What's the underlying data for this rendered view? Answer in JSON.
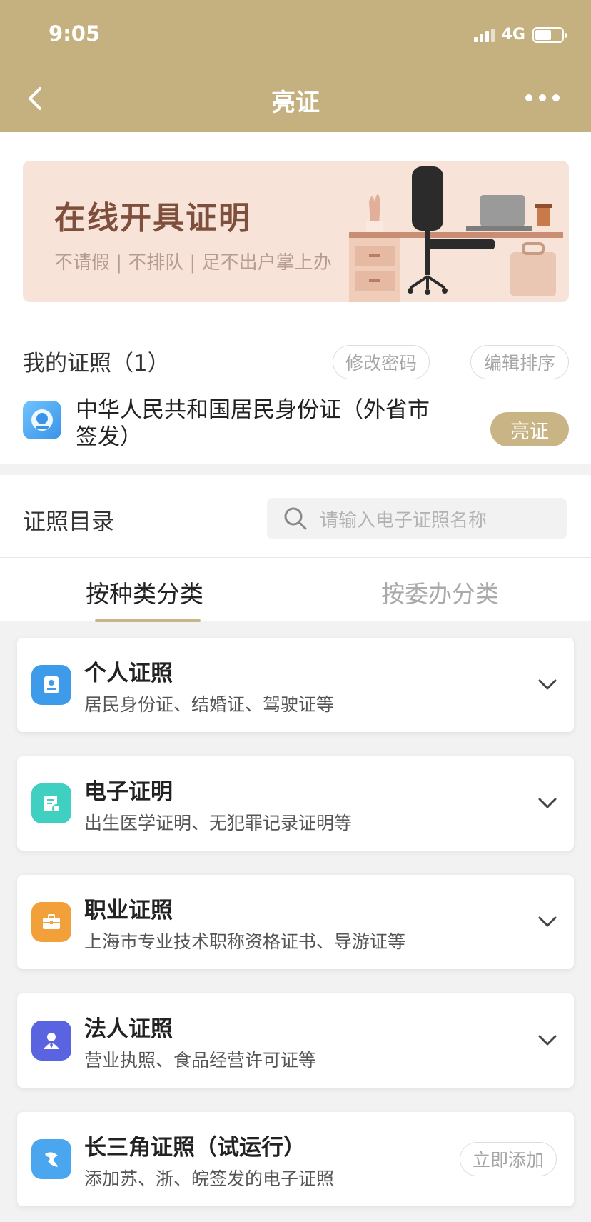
{
  "status_bar": {
    "time": "9:05",
    "network": "4G"
  },
  "nav": {
    "title": "亮证"
  },
  "banner": {
    "title": "在线开具证明",
    "subtitle": "不请假 | 不排队 | 足不出户掌上办"
  },
  "my_licenses": {
    "heading": "我的证照（1）",
    "change_password_label": "修改密码",
    "edit_order_label": "编辑排序",
    "items": [
      {
        "name": "中华人民共和国居民身份证（外省市签发）",
        "action_label": "亮证"
      }
    ]
  },
  "catalog": {
    "title": "证照目录",
    "search_placeholder": "请输入电子证照名称",
    "tabs": [
      {
        "label": "按种类分类",
        "active": true
      },
      {
        "label": "按委办分类",
        "active": false
      }
    ],
    "categories": [
      {
        "title": "个人证照",
        "subtitle": "居民身份证、结婚证、驾驶证等",
        "icon": "id-card-icon",
        "color": "#3d9be9"
      },
      {
        "title": "电子证明",
        "subtitle": "出生医学证明、无犯罪记录证明等",
        "icon": "certificate-icon",
        "color": "#3fd0c2"
      },
      {
        "title": "职业证照",
        "subtitle": "上海市专业技术职称资格证书、导游证等",
        "icon": "briefcase-icon",
        "color": "#f2a03a"
      },
      {
        "title": "法人证照",
        "subtitle": "营业执照、食品经营许可证等",
        "icon": "person-badge-icon",
        "color": "#5a63e0"
      },
      {
        "title": "长三角证照（试运行）",
        "subtitle": "添加苏、浙、皖签发的电子证照",
        "icon": "yangtze-delta-icon",
        "color": "#4aa6ee",
        "action_label": "立即添加"
      }
    ]
  },
  "colors": {
    "header": "#c5b17f",
    "accent": "#c8b484",
    "banner_bg": "#f7e3d8",
    "banner_title": "#7f4f3e"
  }
}
